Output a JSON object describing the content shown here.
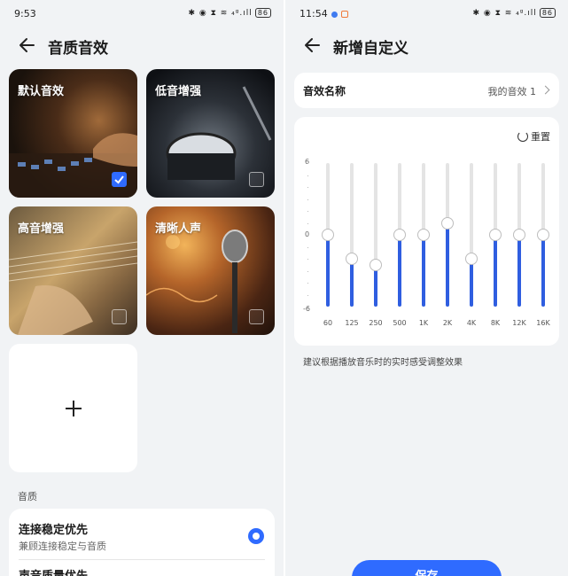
{
  "left": {
    "status": {
      "time": "9:53",
      "icons": "✱ ◉ ⧗ ≋ ₄ᵍ.ıll",
      "battery": "86"
    },
    "header": {
      "title": "音质音效"
    },
    "presets": [
      {
        "label": "默认音效",
        "selected": true
      },
      {
        "label": "低音增强",
        "selected": false
      },
      {
        "label": "高音增强",
        "selected": false
      },
      {
        "label": "清晰人声",
        "selected": false
      }
    ],
    "add_icon": "plus-icon",
    "quality": {
      "section_label": "音质",
      "options": [
        {
          "title": "连接稳定优先",
          "subtitle": "兼顾连接稳定与音质",
          "selected": true
        },
        {
          "title": "声音质量优先"
        }
      ]
    }
  },
  "right": {
    "status": {
      "time": "11:54",
      "icons": "✱ ◉ ⧗ ≋ ₄ᵍ.ıll",
      "battery": "86"
    },
    "header": {
      "title": "新增自定义"
    },
    "name_row": {
      "label": "音效名称",
      "value": "我的音效 1"
    },
    "equalizer": {
      "reset_label": "重置",
      "y_top": "6",
      "y_mid": "0",
      "y_bottom": "-6",
      "bands": [
        {
          "label": "60",
          "gain": 0
        },
        {
          "label": "125",
          "gain": -2
        },
        {
          "label": "250",
          "gain": -2.5
        },
        {
          "label": "500",
          "gain": 0
        },
        {
          "label": "1K",
          "gain": 0
        },
        {
          "label": "2K",
          "gain": 1
        },
        {
          "label": "4K",
          "gain": -2
        },
        {
          "label": "8K",
          "gain": 0
        },
        {
          "label": "12K",
          "gain": 0
        },
        {
          "label": "16K",
          "gain": 0
        }
      ]
    },
    "hint": "建议根据播放音乐时的实时感受调整效果",
    "save_label": "保存"
  },
  "colors": {
    "accent": "#2f6bff",
    "eq_fill": "#2f5ee0",
    "background": "#f1f3f5"
  }
}
